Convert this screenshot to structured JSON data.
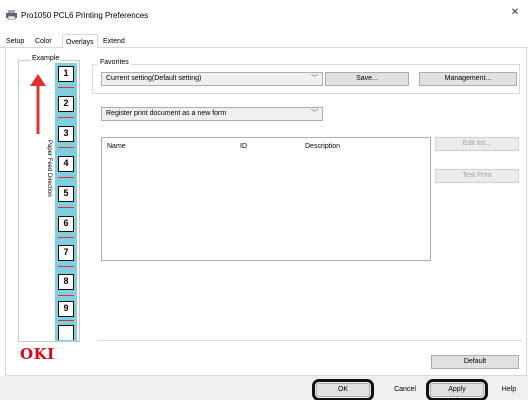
{
  "window": {
    "title": "Pro1050 PCL6 Printing Preferences",
    "close_glyph": "✕"
  },
  "tabs": [
    {
      "label": "Setup"
    },
    {
      "label": "Color"
    },
    {
      "label": "Overlays"
    },
    {
      "label": "Extend"
    }
  ],
  "example": {
    "label": "Example",
    "direction_text": "Paper Feed Direction",
    "pages": [
      "1",
      "2",
      "3",
      "4",
      "5",
      "6",
      "7",
      "8",
      "9"
    ],
    "logo": "OKI",
    "colors": {
      "page_strip": "#7ecfe0",
      "arrow": "#e03030",
      "logo": "#e60012"
    }
  },
  "favorites": {
    "label": "Favorites",
    "current": "Current setting(Default setting)",
    "save_label": "Save...",
    "management_label": "Management..."
  },
  "register": {
    "value": "Register print document as a new form"
  },
  "form_list": {
    "columns": [
      "Name",
      "ID",
      "Description"
    ],
    "edit_label": "Edit list...",
    "test_print_label": "Test Print"
  },
  "default_label": "Default",
  "footer": {
    "ok": "OK",
    "cancel": "Cancel",
    "apply": "Apply",
    "help": "Help"
  }
}
